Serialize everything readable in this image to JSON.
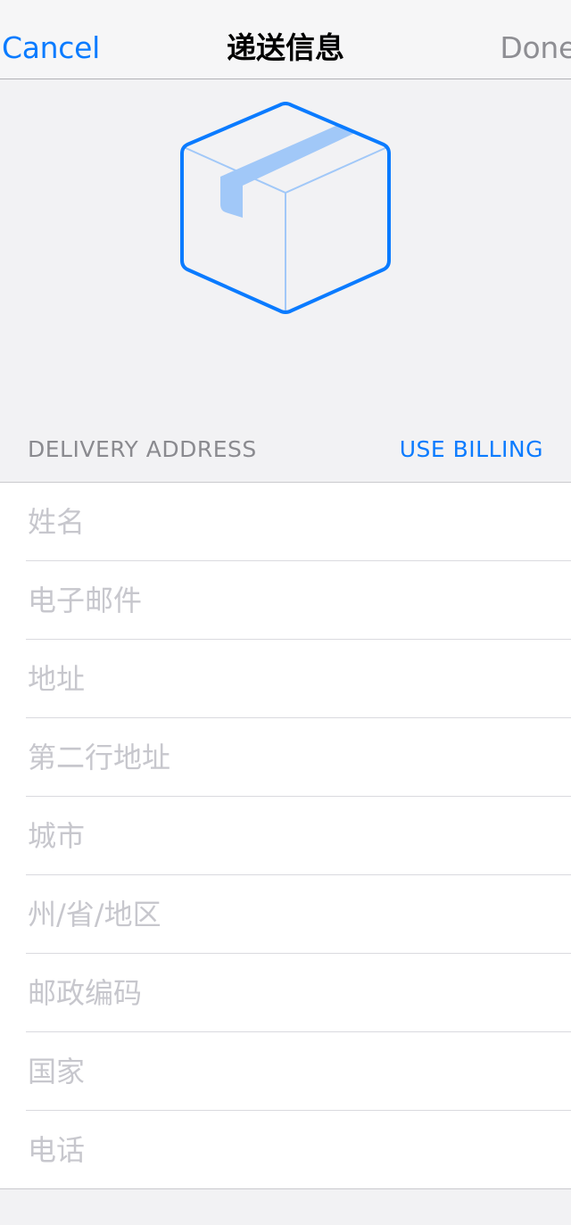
{
  "nav": {
    "cancel_label": "Cancel",
    "title": "递送信息",
    "done_label": "Done"
  },
  "hero": {
    "icon": "package-box-icon",
    "accent_color": "#0a7bff",
    "tape_color": "#a1c8f8"
  },
  "section": {
    "title": "DELIVERY ADDRESS",
    "use_billing_label": "USE BILLING"
  },
  "fields": [
    {
      "placeholder": "姓名",
      "value": ""
    },
    {
      "placeholder": "电子邮件",
      "value": ""
    },
    {
      "placeholder": "地址",
      "value": ""
    },
    {
      "placeholder": "第二行地址",
      "value": ""
    },
    {
      "placeholder": "城市",
      "value": ""
    },
    {
      "placeholder": "州/省/地区",
      "value": ""
    },
    {
      "placeholder": "邮政编码",
      "value": ""
    },
    {
      "placeholder": "国家",
      "value": ""
    },
    {
      "placeholder": "电话",
      "value": ""
    }
  ]
}
